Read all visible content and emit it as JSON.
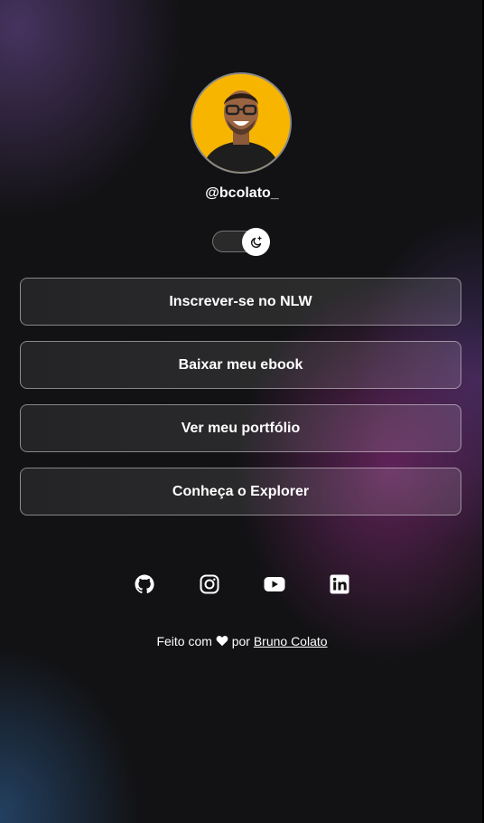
{
  "profile": {
    "username": "@bcolato_",
    "avatar_alt": "Bruno Colato"
  },
  "theme_switch": {
    "icon": "moon-icon",
    "state": "dark"
  },
  "links": [
    {
      "label": "Inscrever-se no NLW"
    },
    {
      "label": "Baixar meu ebook"
    },
    {
      "label": "Ver meu portfólio"
    },
    {
      "label": "Conheça o Explorer"
    }
  ],
  "social": [
    {
      "icon": "github-icon"
    },
    {
      "icon": "instagram-icon"
    },
    {
      "icon": "youtube-icon"
    },
    {
      "icon": "linkedin-icon"
    }
  ],
  "footer": {
    "prefix": "Feito com",
    "middle": "por",
    "author": "Bruno Colato",
    "heart_icon": "heart-icon"
  },
  "colors": {
    "background": "#121214",
    "text": "#ffffff",
    "avatar_bg": "#f7b500",
    "accent_purple": "#782870"
  }
}
